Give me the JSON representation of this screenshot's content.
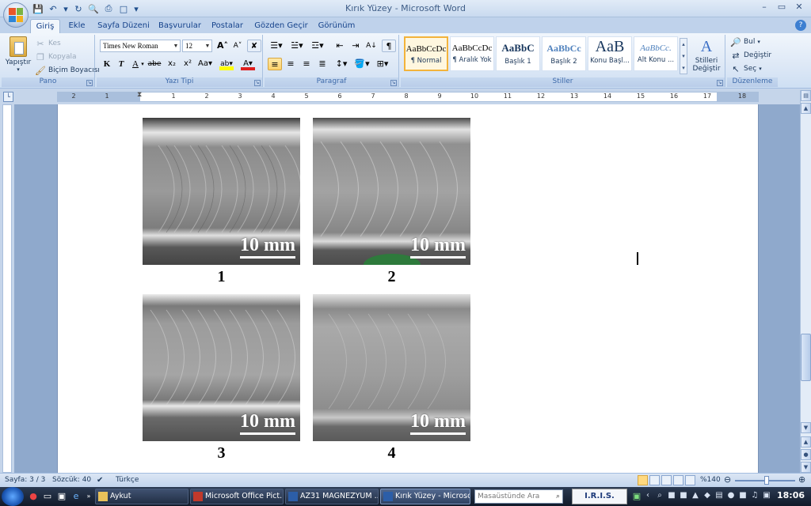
{
  "window": {
    "title": "Kırık Yüzey - Microsoft Word",
    "controls": [
      "minimize",
      "maximize",
      "close"
    ]
  },
  "tabs": [
    "Giriş",
    "Ekle",
    "Sayfa Düzeni",
    "Başvurular",
    "Postalar",
    "Gözden Geçir",
    "Görünüm"
  ],
  "ribbon": {
    "clipboard": {
      "label": "Pano",
      "paste": "Yapıştır",
      "cut": "Kes",
      "copy": "Kopyala",
      "format_painter": "Biçim Boyacısı"
    },
    "font": {
      "label": "Yazı Tipi",
      "family": "Times New Roman",
      "size": "12"
    },
    "paragraph": {
      "label": "Paragraf"
    },
    "styles": {
      "label": "Stiller",
      "items": [
        {
          "preview": "AaBbCcDc",
          "name": "¶ Normal"
        },
        {
          "preview": "AaBbCcDc",
          "name": "¶ Aralık Yok"
        },
        {
          "preview": "AaBbC",
          "name": "Başlık 1"
        },
        {
          "preview": "AaBbCc",
          "name": "Başlık 2"
        },
        {
          "preview": "AaB",
          "name": "Konu Başl..."
        },
        {
          "preview": "AaBbCc.",
          "name": "Alt Konu ..."
        }
      ],
      "change": "Stilleri Değiştir"
    },
    "editing": {
      "label": "Düzenleme",
      "find": "Bul",
      "replace": "Değiştir",
      "select": "Seç"
    }
  },
  "ruler": {
    "marks": [
      "2",
      "1",
      "1",
      "2",
      "3",
      "4",
      "5",
      "6",
      "7",
      "8",
      "9",
      "10",
      "11",
      "12",
      "13",
      "14",
      "15",
      "16",
      "17",
      "18"
    ]
  },
  "document": {
    "figures": [
      {
        "scale": "10 mm",
        "caption": "1"
      },
      {
        "scale": "10 mm",
        "caption": "2"
      },
      {
        "scale": "10 mm",
        "caption": "3"
      },
      {
        "scale": "10 mm",
        "caption": "4"
      }
    ]
  },
  "statusbar": {
    "page": "Sayfa: 3 / 3",
    "words": "Sözcük: 40",
    "language": "Türkçe",
    "zoom": "%140"
  },
  "taskbar": {
    "tasks": [
      {
        "label": "Aykut",
        "active": false
      },
      {
        "label": "Microsoft Office Pict...",
        "active": false
      },
      {
        "label": "AZ31 MAGNEZYUM ...",
        "active": false
      },
      {
        "label": "Kırık Yüzey - Microso...",
        "active": true
      }
    ],
    "search_placeholder": "Masaüstünde Ara",
    "iris": "I.R.I.S.",
    "clock": "18:06"
  }
}
